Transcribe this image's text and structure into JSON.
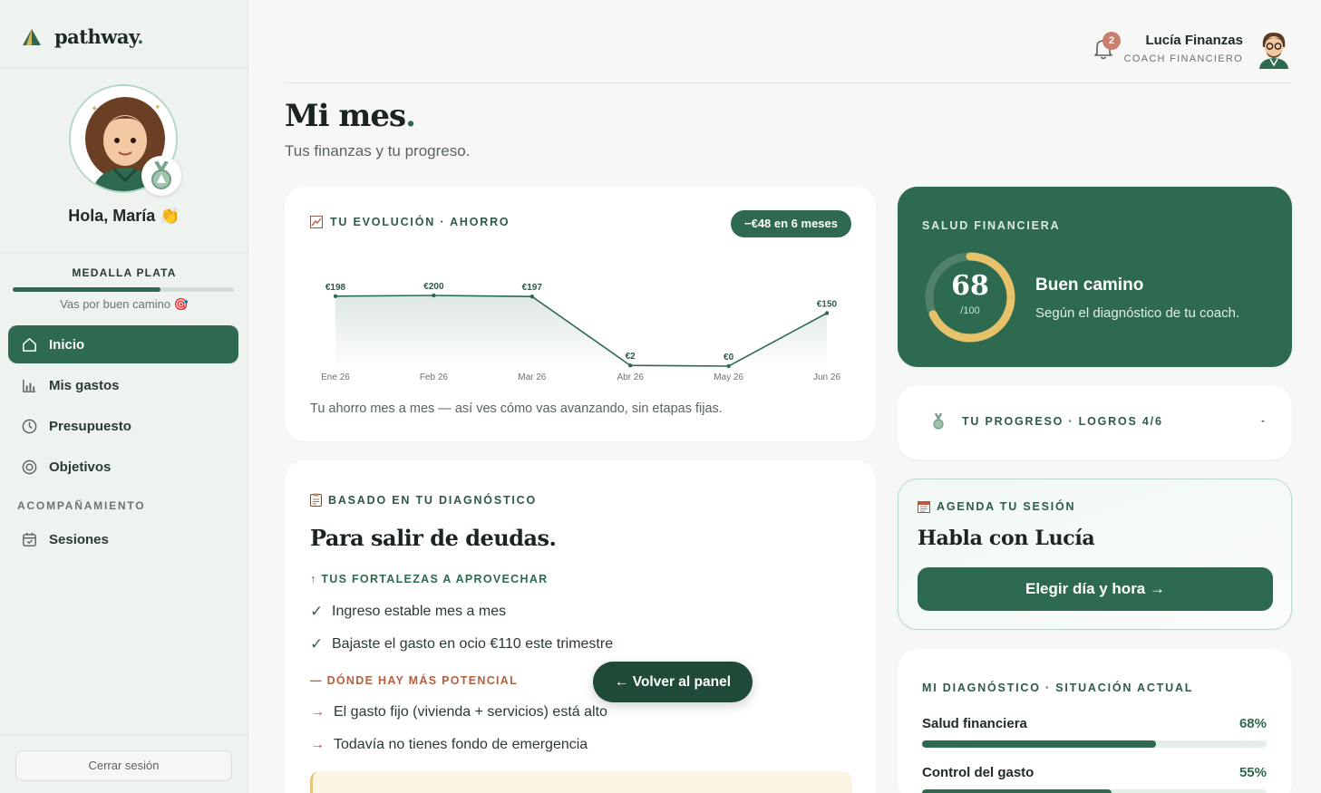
{
  "app": {
    "name": "pathway",
    "name_dot": "."
  },
  "sidebar": {
    "greeting": "Hola, María 👏",
    "medal": {
      "title": "MEDALLA PLATA",
      "subtitle": "Vas por buen camino 🎯",
      "progress": 0.67
    },
    "nav": [
      {
        "label": "Inicio",
        "icon": "home-icon",
        "active": true
      },
      {
        "label": "Mis gastos",
        "icon": "bar-chart-icon",
        "active": false
      },
      {
        "label": "Presupuesto",
        "icon": "clock-icon",
        "active": false
      },
      {
        "label": "Objetivos",
        "icon": "target-icon",
        "active": false
      }
    ],
    "section_label": "ACOMPAÑAMIENTO",
    "section_items": [
      {
        "label": "Sesiones",
        "icon": "calendar-icon"
      }
    ],
    "logout": "Cerrar sesión"
  },
  "header": {
    "notifications": "2",
    "coach_name": "Lucía Finanzas",
    "coach_role": "COACH FINANCIERO"
  },
  "page": {
    "title": "Mi mes",
    "title_dot": ".",
    "subtitle": "Tus finanzas y tu progreso."
  },
  "evolution": {
    "eyebrow": "TU EVOLUCIÓN · AHORRO",
    "pill": "−€48 en 6 meses",
    "note": "Tu ahorro mes a mes — así ves cómo vas avanzando, sin etapas fijas."
  },
  "chart_data": {
    "type": "area",
    "categories": [
      "Ene 26",
      "Feb 26",
      "Mar 26",
      "Abr 26",
      "May 26",
      "Jun 26"
    ],
    "values": [
      198,
      200,
      197,
      2,
      0,
      150
    ],
    "labels": [
      "€198",
      "€200",
      "€197",
      "€2",
      "€0",
      "€150"
    ],
    "ylim": [
      0,
      200
    ],
    "color": "#2e6a4f"
  },
  "health": {
    "eyebrow": "SALUD FINANCIERA",
    "score": "68",
    "max": "/100",
    "fraction": 0.68,
    "title": "Buen camino",
    "subtitle": "Según el diagnóstico de tu coach.",
    "gauge_color": "#e8c26a"
  },
  "progress": {
    "eyebrow": "TU PROGRESO · LOGROS 4/6"
  },
  "session": {
    "eyebrow": "AGENDA TU SESIÓN",
    "title": "Habla con Lucía",
    "button": "Elegir día y hora →"
  },
  "diagnosis": {
    "eyebrow": "MI DIAGNÓSTICO · SITUACIÓN ACTUAL",
    "metrics": [
      {
        "label": "Salud financiera",
        "value": "68%",
        "fraction": 0.68
      },
      {
        "label": "Control del gasto",
        "value": "55%",
        "fraction": 0.55
      }
    ]
  },
  "plan": {
    "eyebrow": "BASADO EN TU DIAGNÓSTICO",
    "title": "Para salir de deudas.",
    "strengths_title": "↑ TUS FORTALEZAS A APROVECHAR",
    "strengths": [
      "Ingreso estable mes a mes",
      "Bajaste el gasto en ocio €110 este trimestre"
    ],
    "potential_title": "— DÓNDE HAY MÁS POTENCIAL",
    "potential": [
      "El gasto fijo (vivienda + servicios) está alto",
      "Todavía no tienes fondo de emergencia"
    ]
  },
  "back_button": "← Volver al panel"
}
